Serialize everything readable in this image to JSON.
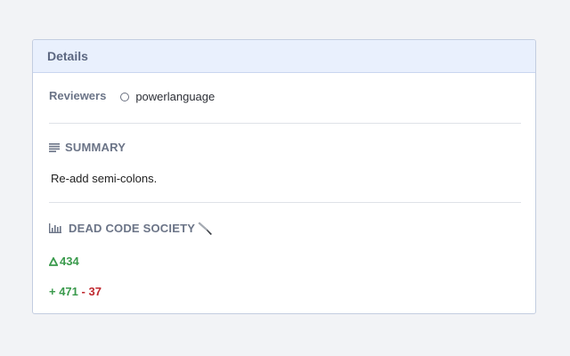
{
  "details": {
    "title": "Details"
  },
  "reviewers": {
    "label": "Reviewers",
    "items": [
      {
        "name": "powerlanguage",
        "status_icon": "circle-icon"
      }
    ]
  },
  "summary": {
    "icon": "lines-icon",
    "heading": "SUMMARY",
    "text": "Re-add semi-colons."
  },
  "dead_code_society": {
    "icon": "bar-chart-icon",
    "heading": "DEAD CODE SOCIETY",
    "heading_emoji": "knife-icon",
    "delta_icon": "delta-icon",
    "delta": "434",
    "added": "+ 471",
    "separator": "-",
    "removed": "37"
  },
  "colors": {
    "header_bg": "#e9f0fd",
    "positive": "#3a9a4c",
    "negative": "#c0292f",
    "muted": "#6b7487"
  }
}
